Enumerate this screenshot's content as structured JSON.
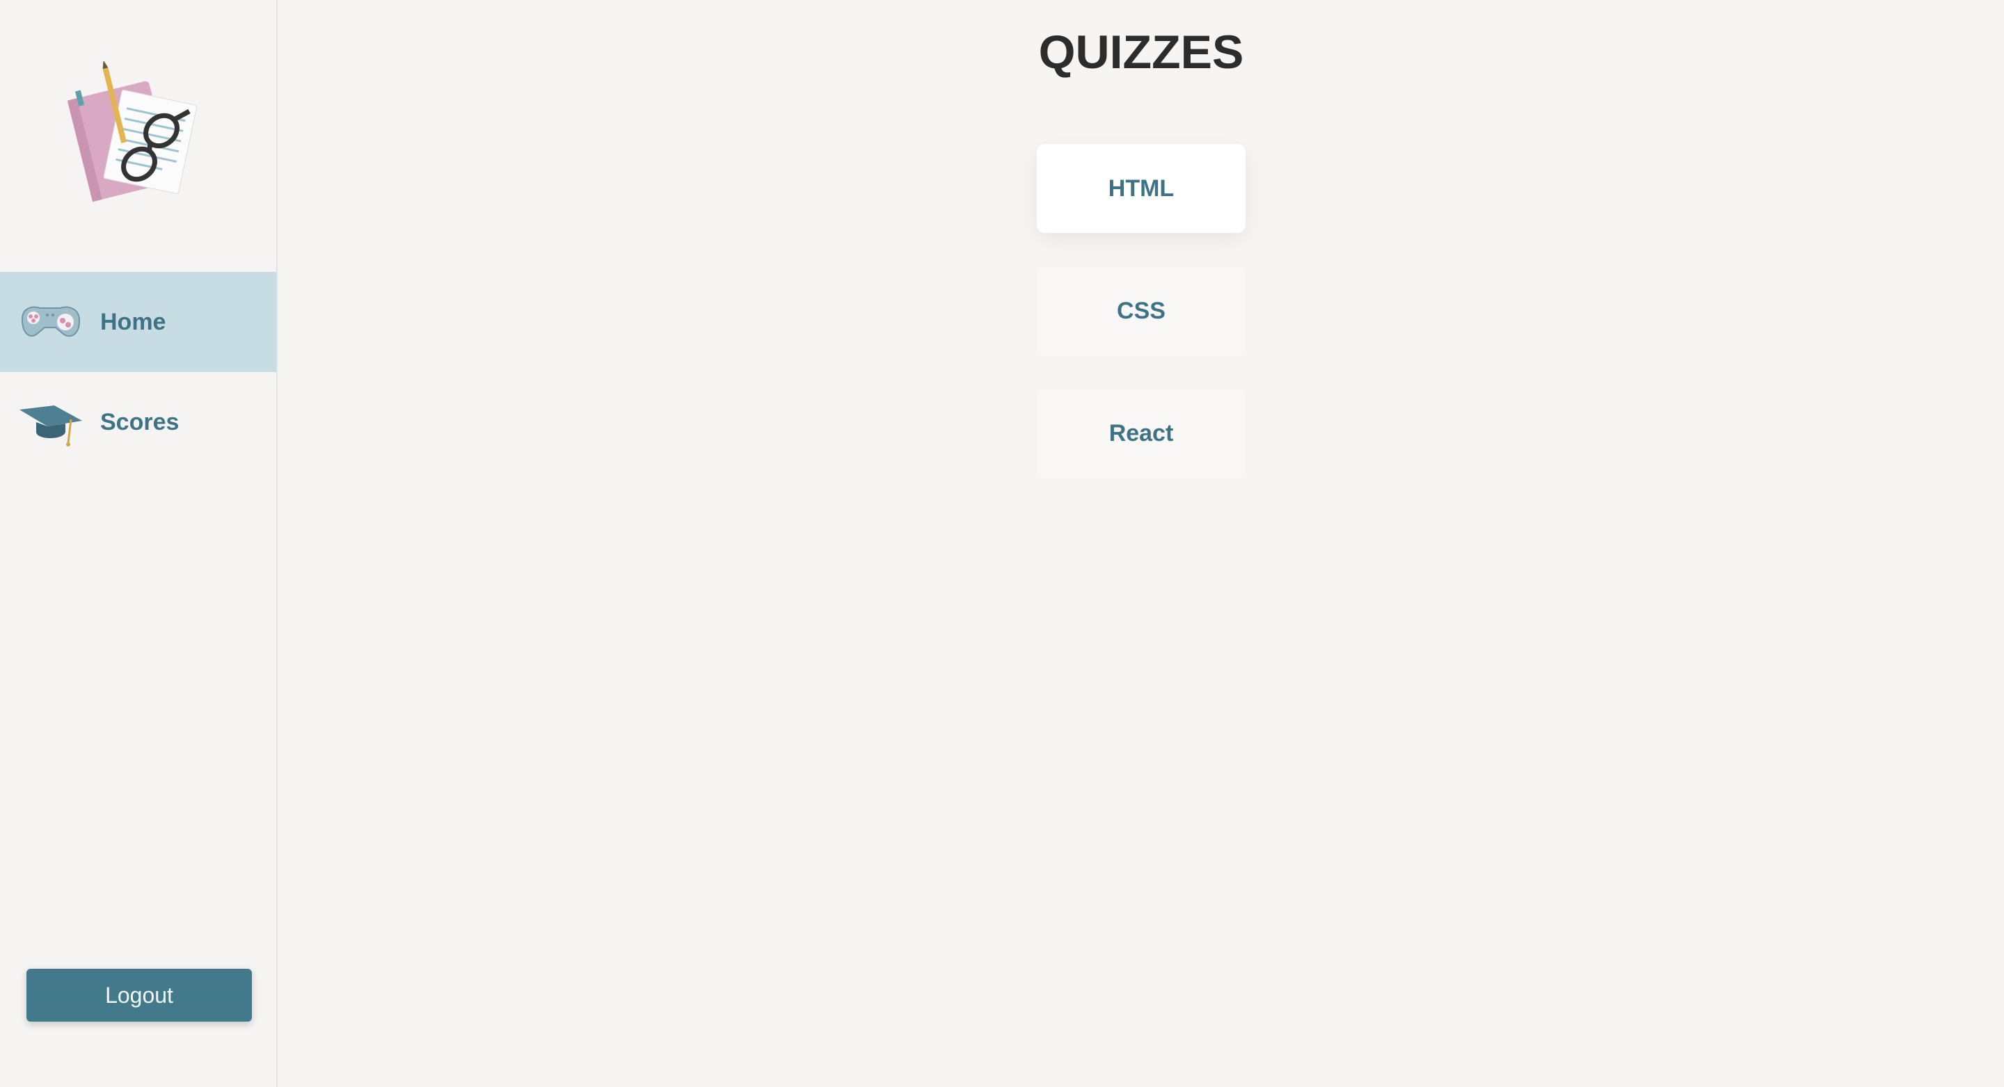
{
  "sidebar": {
    "logo_icon": "notebook-glasses-icon",
    "items": [
      {
        "label": "Home",
        "icon": "gamepad-icon",
        "active": true
      },
      {
        "label": "Scores",
        "icon": "graduation-cap-icon",
        "active": false
      }
    ],
    "logout_label": "Logout"
  },
  "main": {
    "title": "QUIZZES",
    "quizzes": [
      {
        "label": "HTML",
        "selected": true
      },
      {
        "label": "CSS",
        "selected": false
      },
      {
        "label": "React",
        "selected": false
      }
    ]
  },
  "colors": {
    "accent": "#437a8b",
    "active_nav_bg": "#c8dce3",
    "text_accent": "#3d7385",
    "page_bg": "#f6f5f3"
  }
}
